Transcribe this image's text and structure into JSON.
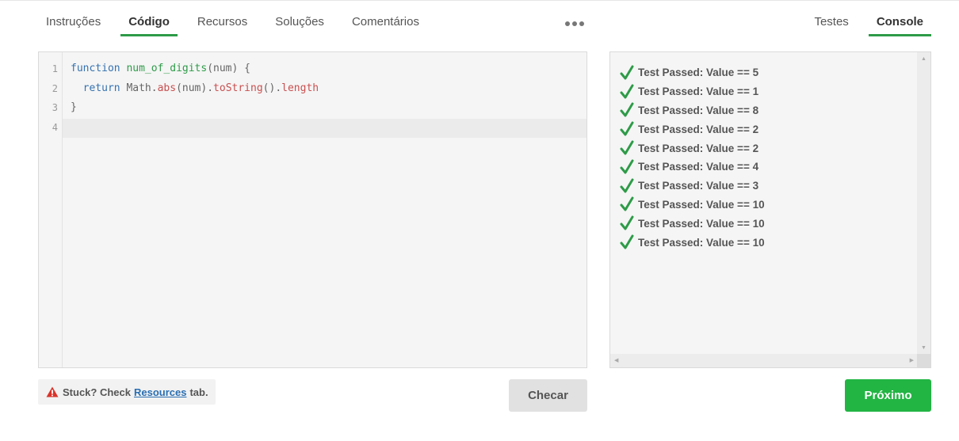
{
  "tabs_left": [
    {
      "label": "Instruções",
      "active": false
    },
    {
      "label": "Código",
      "active": true
    },
    {
      "label": "Recursos",
      "active": false
    },
    {
      "label": "Soluções",
      "active": false
    },
    {
      "label": "Comentários",
      "active": false
    }
  ],
  "tabs_right": [
    {
      "label": "Testes",
      "active": false
    },
    {
      "label": "Console",
      "active": true
    }
  ],
  "more_icon": "more-horizontal-icon",
  "editor": {
    "line_numbers": [
      "1",
      "2",
      "3",
      "4"
    ],
    "code": {
      "l1_kw": "function",
      "l1_fn": "num_of_digits",
      "l1_rest": "(num) {",
      "l2_kw": "return",
      "l2_obj": "Math.",
      "l2_abs": "abs",
      "l2_arg": "(num).",
      "l2_tostring": "toString",
      "l2_paren": "().",
      "l2_length": "length",
      "l3": "}"
    },
    "colors": {
      "keyword": "#3572b0",
      "function": "#2e9b48",
      "property": "#c94f4f"
    }
  },
  "console": {
    "results": [
      "Test Passed: Value == 5",
      "Test Passed: Value == 1",
      "Test Passed: Value == 8",
      "Test Passed: Value == 2",
      "Test Passed: Value == 2",
      "Test Passed: Value == 4",
      "Test Passed: Value == 3",
      "Test Passed: Value == 10",
      "Test Passed: Value == 10",
      "Test Passed: Value == 10"
    ],
    "icon": "check-icon",
    "icon_color": "#2e9b48"
  },
  "hint": {
    "prefix": "Stuck? Check",
    "link": "Resources",
    "suffix": "tab.",
    "icon": "warning-icon",
    "icon_color": "#d9342b"
  },
  "buttons": {
    "check_label": "Checar",
    "next_label": "Próximo",
    "next_color": "#22b543"
  }
}
